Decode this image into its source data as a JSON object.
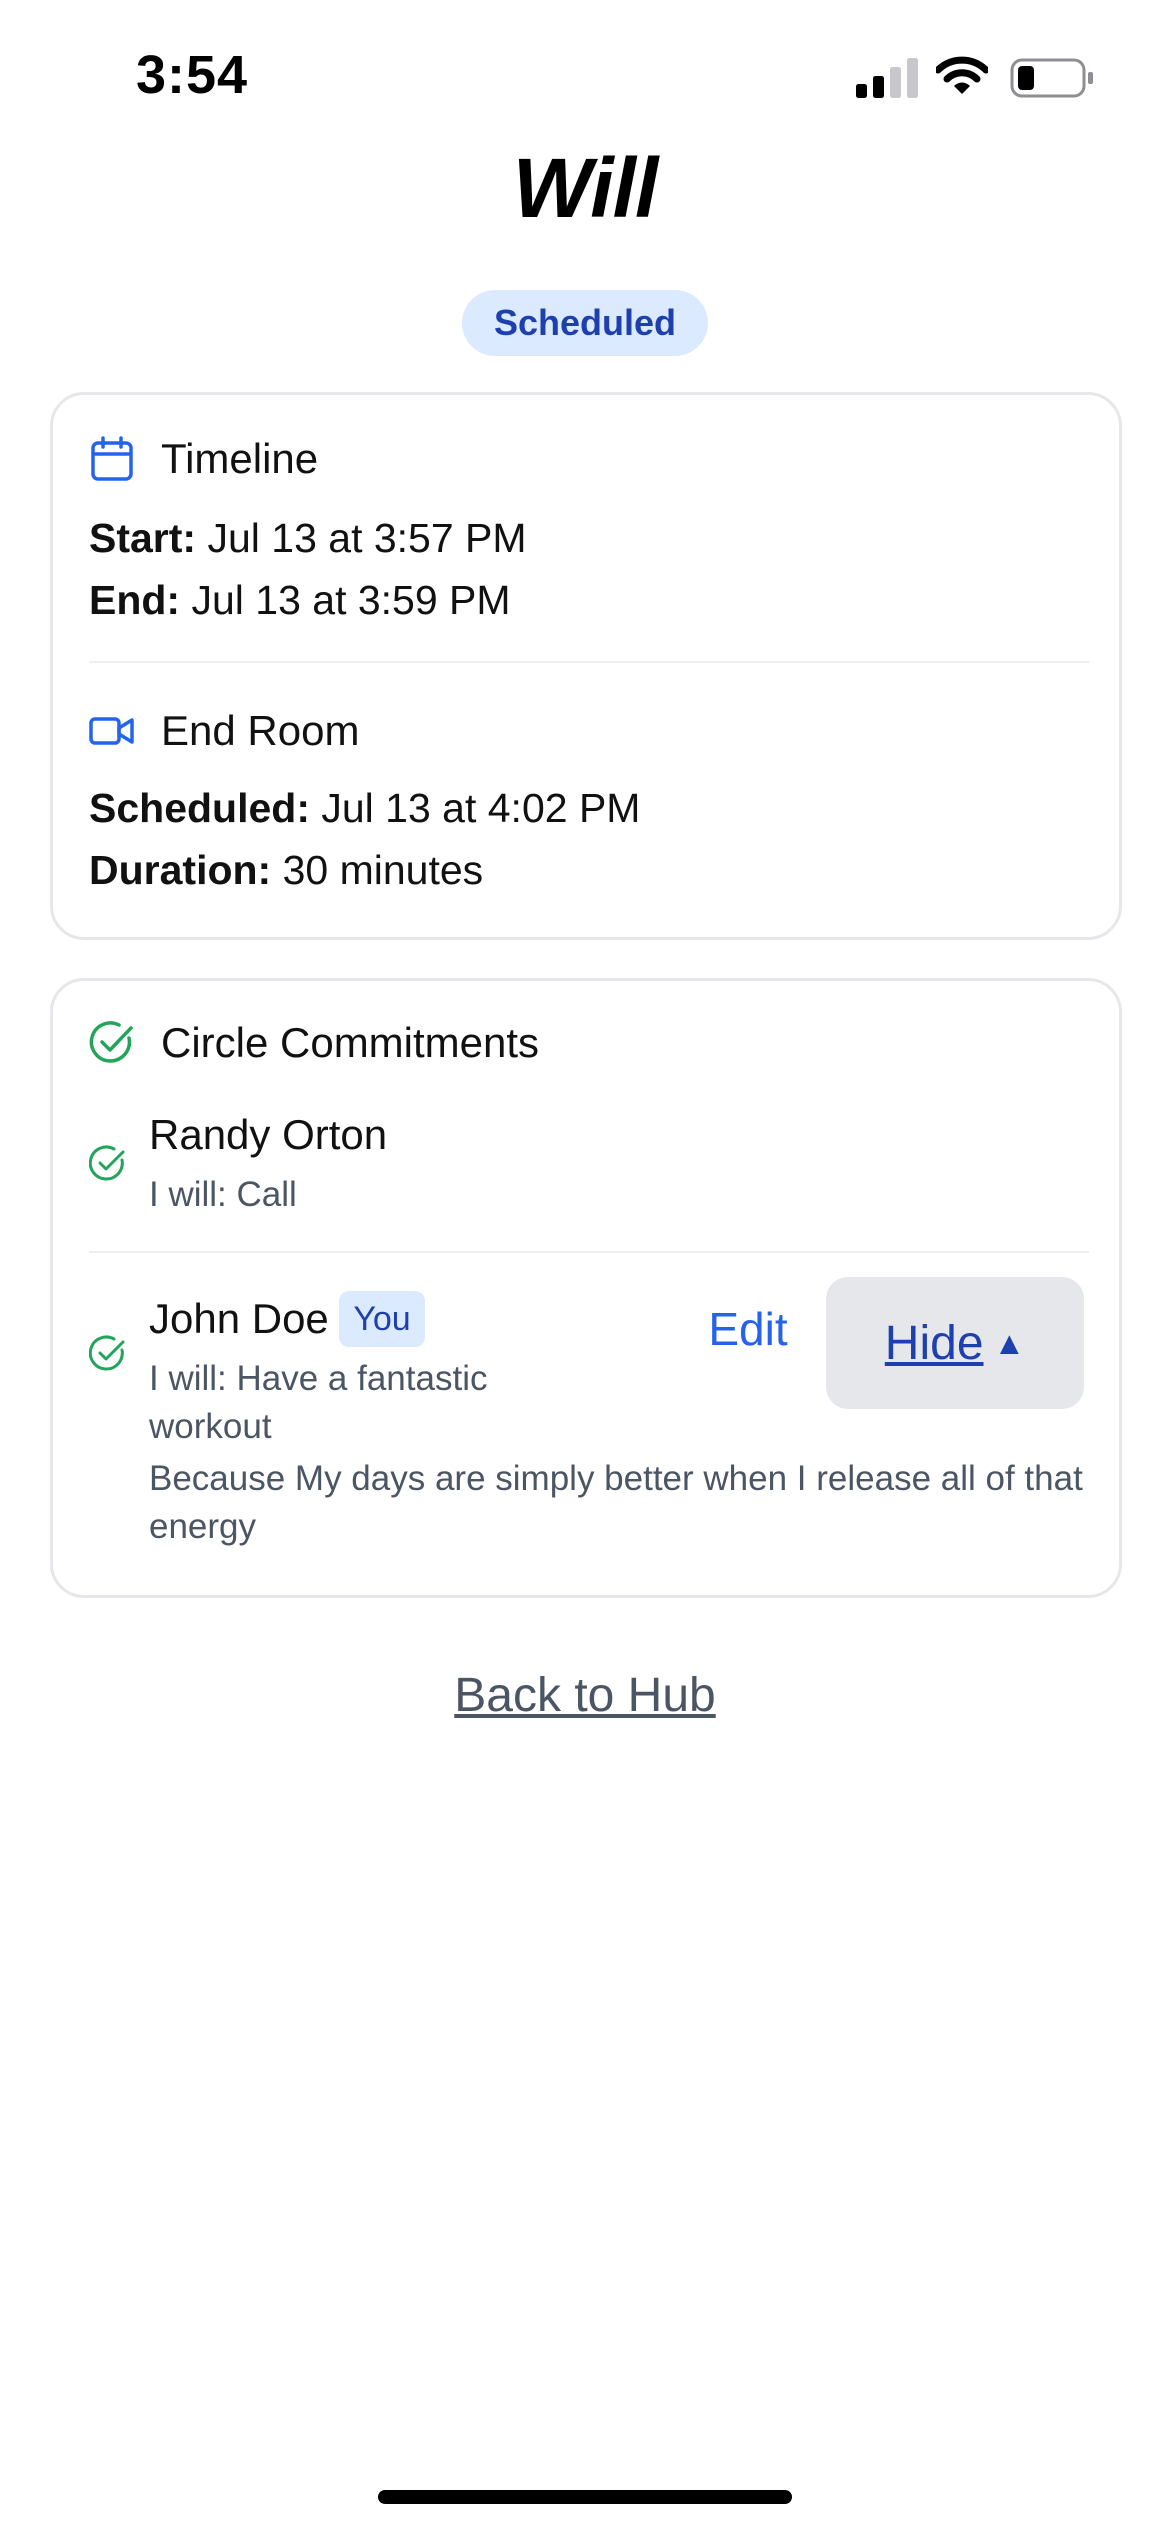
{
  "status_bar": {
    "time": "3:54",
    "icons": [
      "cellular-signal-icon",
      "wifi-icon",
      "battery-icon"
    ]
  },
  "title": "Will",
  "status": "Scheduled",
  "colors": {
    "accent": "#2563eb",
    "badge_bg": "#dbeafe",
    "badge_text": "#1e40af",
    "success": "#22a55a",
    "muted_text": "#4b5563",
    "card_border": "#e5e7eb"
  },
  "timeline": {
    "icon": "calendar-icon",
    "heading": "Timeline",
    "start_label": "Start:",
    "start_value": " Jul 13 at 3:57 PM",
    "end_label": "End:",
    "end_value": " Jul 13 at 3:59 PM"
  },
  "end_room": {
    "icon": "video-camera-icon",
    "heading": "End Room",
    "scheduled_label": "Scheduled:",
    "scheduled_value": " Jul 13 at 4:02 PM",
    "duration_label": "Duration:",
    "duration_value": " 30 minutes"
  },
  "commitments": {
    "icon": "check-circle-icon",
    "heading": "Circle Commitments",
    "members": [
      {
        "name": "Randy Orton",
        "will": "I will: Call"
      },
      {
        "name": "John Doe",
        "badge": "You",
        "will": "I will: Have a fantastic workout",
        "because": "Because My days are simply better when I release all of that energy",
        "edit_label": "Edit",
        "hide_label": "Hide",
        "hide_icon": "▲"
      }
    ]
  },
  "back_link": "Back to Hub"
}
